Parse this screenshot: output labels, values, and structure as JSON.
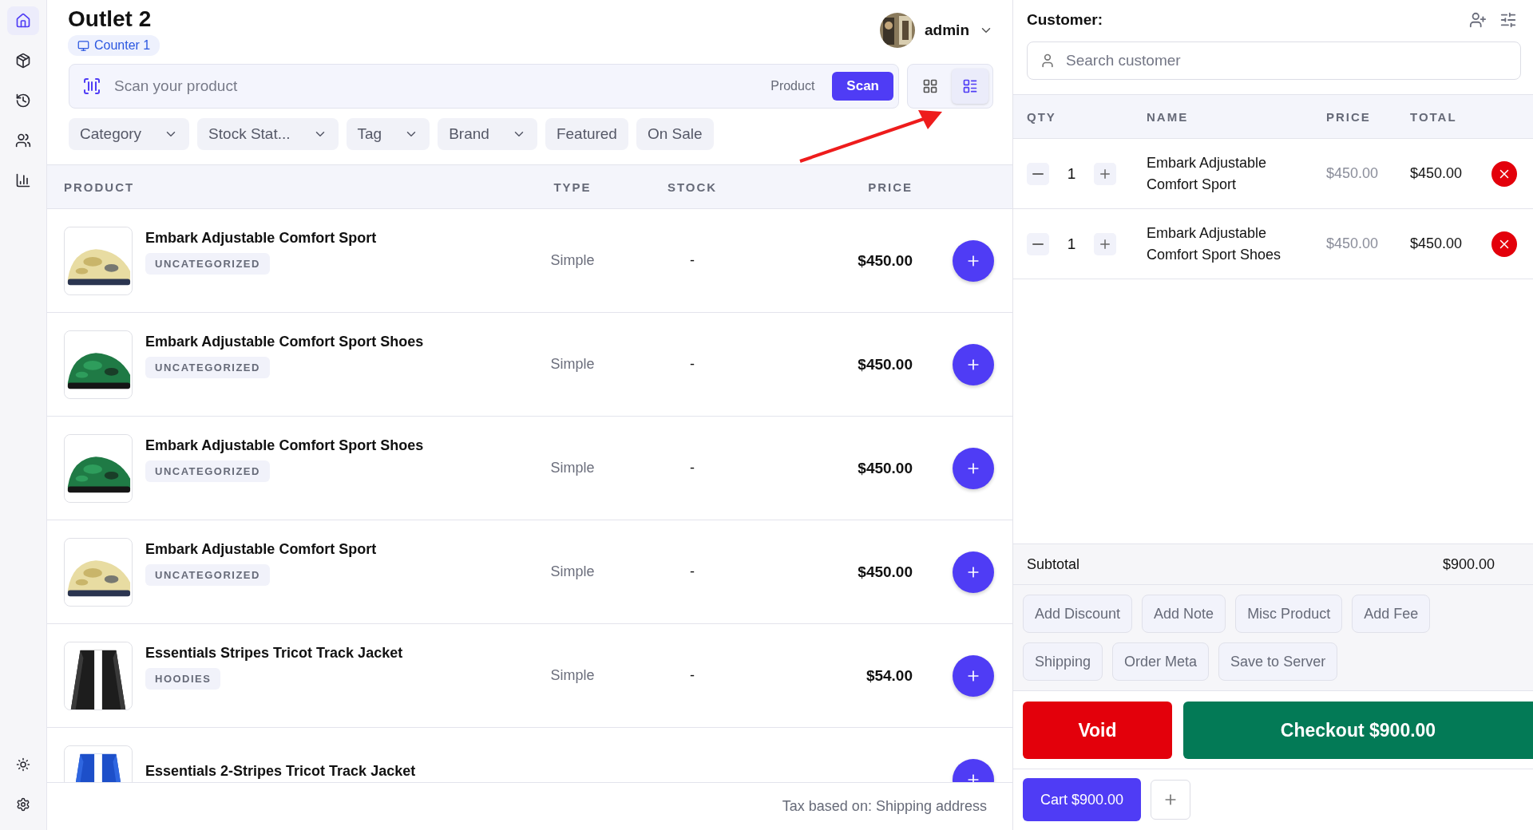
{
  "sidebar": {
    "items": [
      {
        "selected": true
      },
      {
        "selected": false
      },
      {
        "selected": false
      },
      {
        "selected": false
      },
      {
        "selected": false
      }
    ]
  },
  "header": {
    "title": "Outlet 2",
    "counter": "Counter 1",
    "user": "admin"
  },
  "scan": {
    "placeholder": "Scan your product",
    "mode": "Product",
    "button": "Scan"
  },
  "view_toggle": [
    {
      "selected": false
    },
    {
      "selected": true
    }
  ],
  "filters": [
    {
      "label": "Category",
      "kind": "dropdown"
    },
    {
      "label": "Stock Stat...",
      "kind": "dropdown"
    },
    {
      "label": "Tag",
      "kind": "dropdown"
    },
    {
      "label": "Brand",
      "kind": "dropdown"
    },
    {
      "label": "Featured",
      "kind": "toggle"
    },
    {
      "label": "On Sale",
      "kind": "toggle"
    }
  ],
  "products": {
    "columns": [
      "PRODUCT",
      "TYPE",
      "STOCK",
      "PRICE"
    ],
    "rows": [
      {
        "name": "Embark Adjustable Comfort Sport",
        "tag": "UNCATEGORIZED",
        "type": "Simple",
        "stock": "-",
        "price": "$450.00"
      },
      {
        "name": "Embark Adjustable Comfort Sport Shoes",
        "tag": "UNCATEGORIZED",
        "type": "Simple",
        "stock": "-",
        "price": "$450.00"
      },
      {
        "name": "Embark Adjustable Comfort Sport Shoes",
        "tag": "UNCATEGORIZED",
        "type": "Simple",
        "stock": "-",
        "price": "$450.00"
      },
      {
        "name": "Embark Adjustable Comfort Sport",
        "tag": "UNCATEGORIZED",
        "type": "Simple",
        "stock": "-",
        "price": "$450.00"
      },
      {
        "name": "Essentials Stripes Tricot Track Jacket",
        "tag": "HOODIES",
        "type": "Simple",
        "stock": "-",
        "price": "$54.00"
      },
      {
        "name": "Essentials 2-Stripes Tricot Track Jacket"
      }
    ]
  },
  "footer": {
    "tax_note": "Tax based on: Shipping address"
  },
  "cart": {
    "customer_label": "Customer:",
    "search_placeholder": "Search customer",
    "columns": [
      "QTY",
      "NAME",
      "PRICE",
      "TOTAL"
    ],
    "items": [
      {
        "qty": "1",
        "name": "Embark Adjustable Comfort Sport",
        "price": "$450.00",
        "total": "$450.00"
      },
      {
        "qty": "1",
        "name": "Embark Adjustable Comfort Sport Shoes",
        "price": "$450.00",
        "total": "$450.00"
      }
    ],
    "subtotal_label": "Subtotal",
    "subtotal": "$900.00",
    "actions": [
      "Add Discount",
      "Add Note",
      "Misc Product",
      "Add Fee",
      "Shipping",
      "Order Meta",
      "Save to Server"
    ],
    "void": "Void",
    "checkout": "Checkout $900.00",
    "tabs": [
      {
        "label": "Cart $900.00",
        "selected": true
      }
    ]
  }
}
